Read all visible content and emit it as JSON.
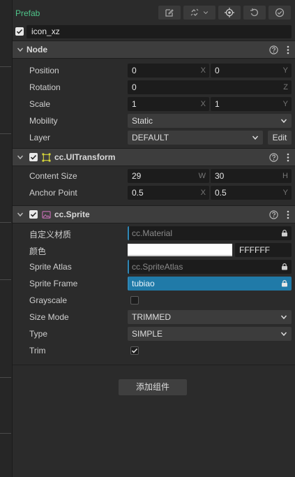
{
  "prefab": {
    "label": "Prefab",
    "tools": [
      "edit-icon",
      "unlink-icon",
      "locate-icon",
      "revert-icon",
      "apply-icon"
    ]
  },
  "node_name": "icon_xz",
  "node": {
    "title": "Node",
    "position": {
      "label": "Position",
      "x": "0",
      "y": "0",
      "x_axis": "X",
      "y_axis": "Y"
    },
    "rotation": {
      "label": "Rotation",
      "z": "0",
      "z_axis": "Z"
    },
    "scale": {
      "label": "Scale",
      "x": "1",
      "y": "1",
      "x_axis": "X",
      "y_axis": "Y"
    },
    "mobility": {
      "label": "Mobility",
      "value": "Static"
    },
    "layer": {
      "label": "Layer",
      "value": "DEFAULT",
      "edit_label": "Edit"
    }
  },
  "uitransform": {
    "title": "cc.UITransform",
    "content_size": {
      "label": "Content Size",
      "w": "29",
      "h": "30",
      "w_axis": "W",
      "h_axis": "H"
    },
    "anchor_point": {
      "label": "Anchor Point",
      "x": "0.5",
      "y": "0.5",
      "x_axis": "X",
      "y_axis": "Y"
    }
  },
  "sprite": {
    "title": "cc.Sprite",
    "custom_material": {
      "label": "自定义材质",
      "value": "cc.Material"
    },
    "color": {
      "label": "颜色",
      "hex": "FFFFFF",
      "swatch": "#ffffff"
    },
    "sprite_atlas": {
      "label": "Sprite Atlas",
      "value": "cc.SpriteAtlas"
    },
    "sprite_frame": {
      "label": "Sprite Frame",
      "value": "tubiao"
    },
    "grayscale": {
      "label": "Grayscale",
      "checked": false
    },
    "size_mode": {
      "label": "Size Mode",
      "value": "TRIMMED"
    },
    "type": {
      "label": "Type",
      "value": "SIMPLE"
    },
    "trim": {
      "label": "Trim",
      "checked": true
    }
  },
  "add_component_label": "添加组件",
  "colors": {
    "accent": "#207aa8",
    "prefab_green": "#4fc48a",
    "uitransform_icon": "#d6d63a",
    "sprite_icon": "#c66fb5"
  }
}
